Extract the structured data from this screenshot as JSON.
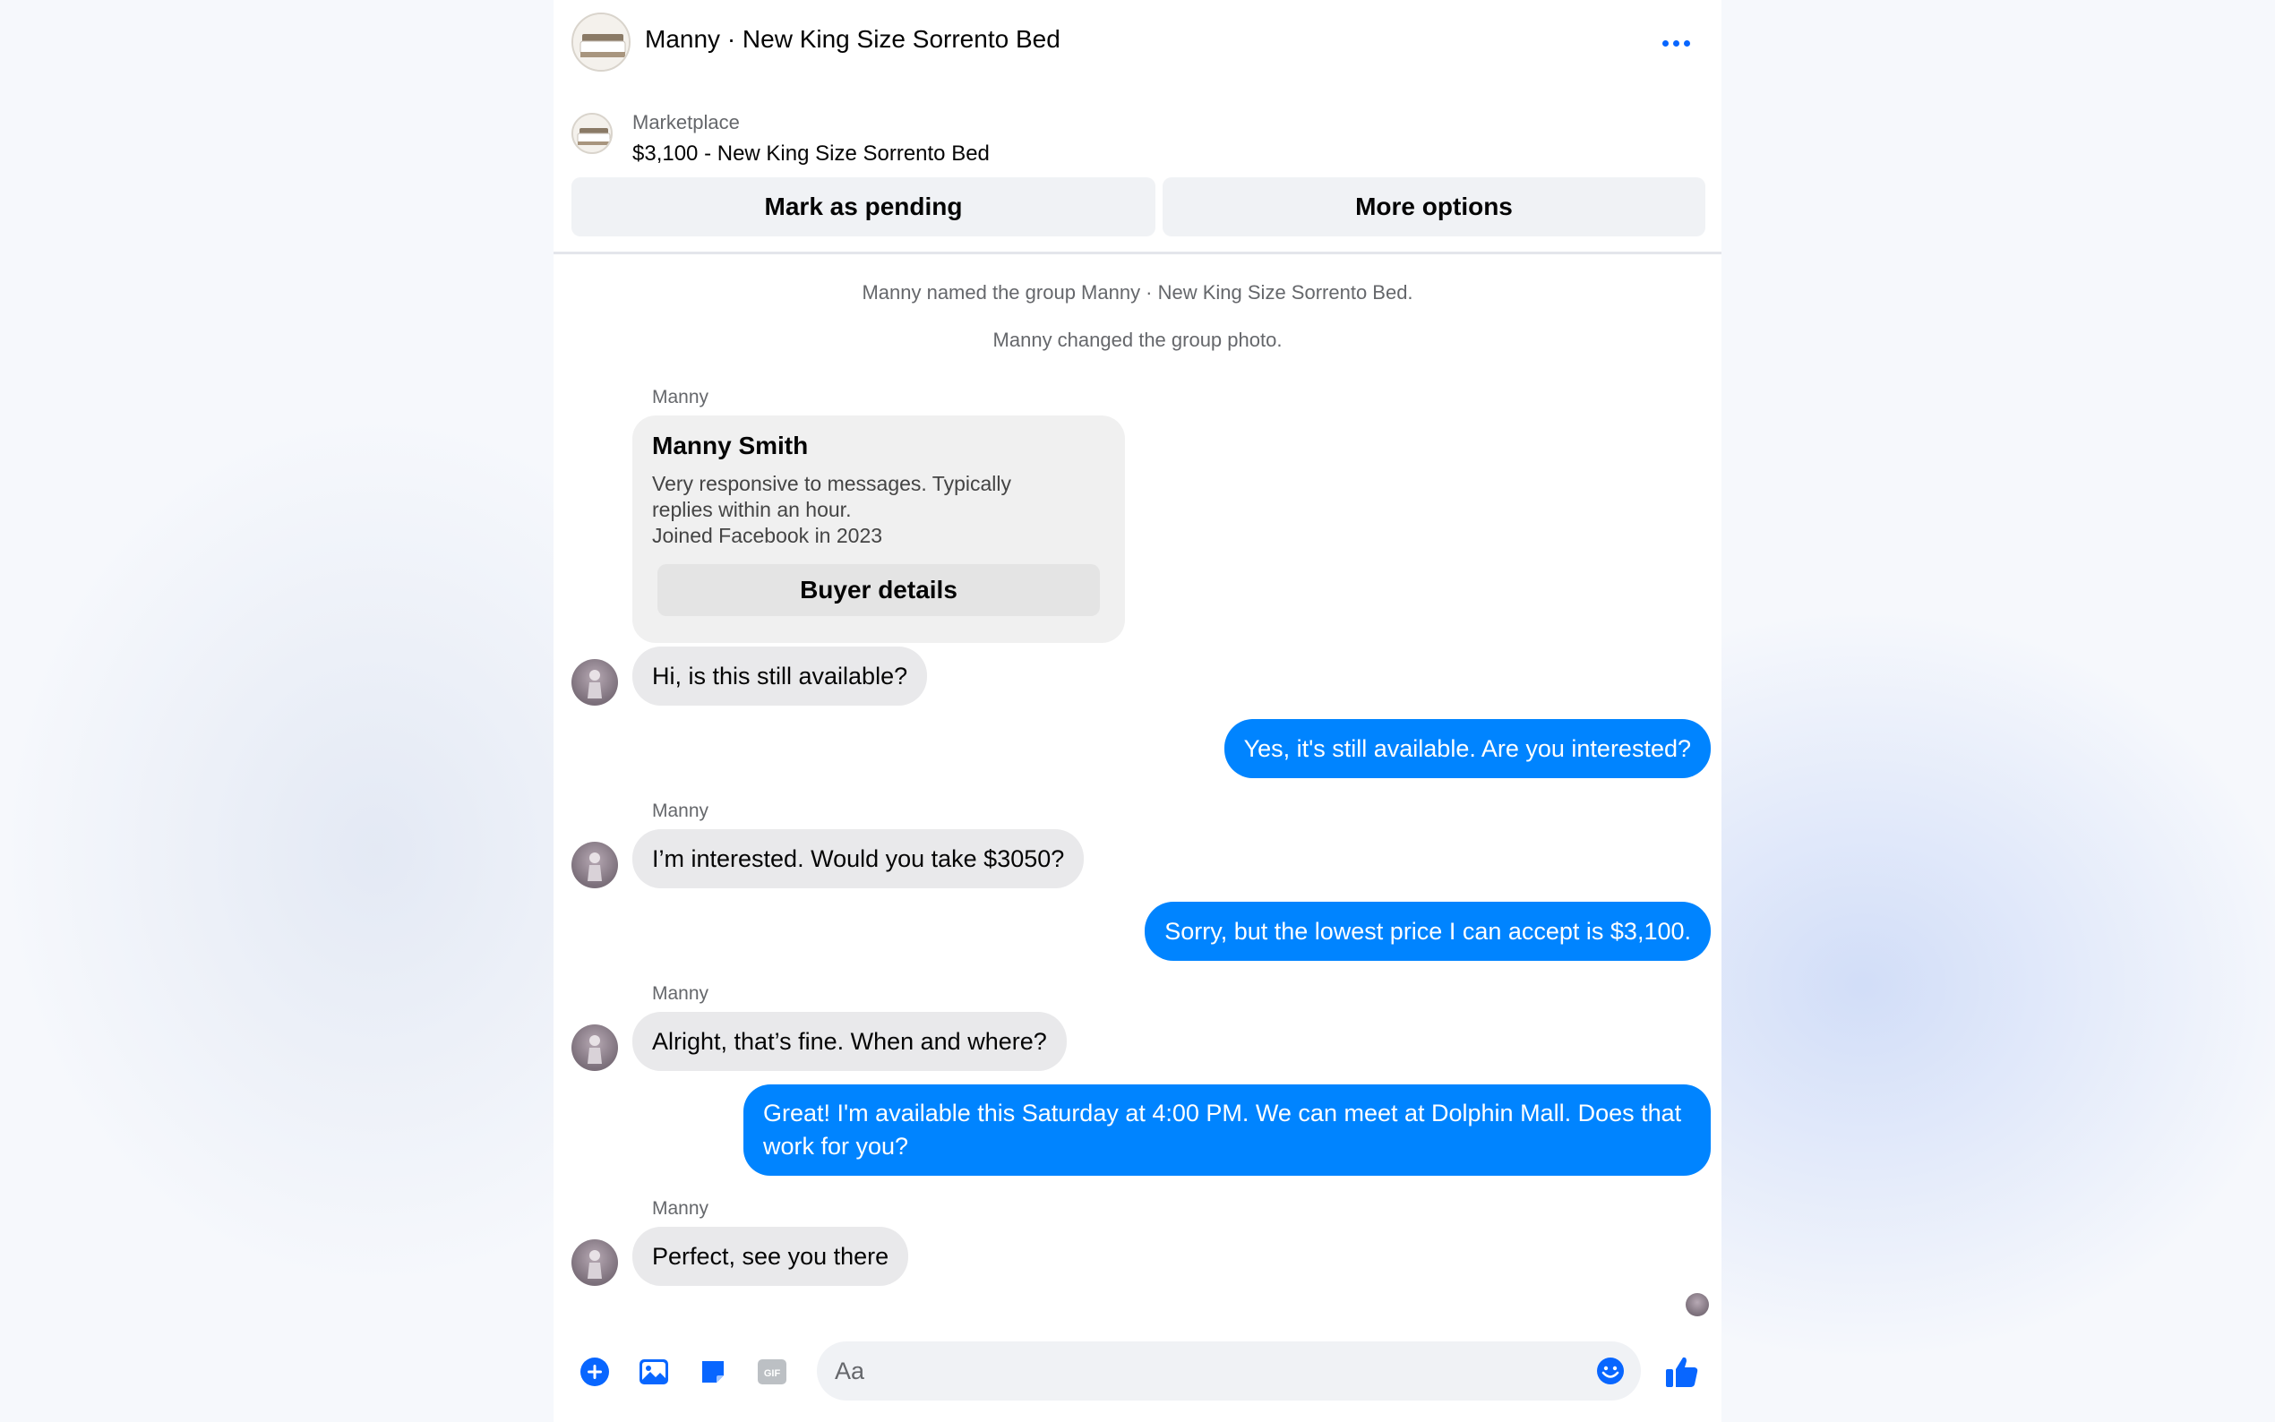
{
  "header": {
    "title": "Manny · New King Size Sorrento Bed",
    "more_icon": "more-horizontal-icon"
  },
  "listing": {
    "label": "Marketplace",
    "title": "$3,100 - New King Size Sorrento Bed",
    "pending_button": "Mark as pending",
    "more_options_button": "More options"
  },
  "system_messages": [
    "Manny named the group Manny · New King Size Sorrento Bed.",
    "Manny changed the group photo."
  ],
  "profile_card": {
    "sender": "Manny",
    "name": "Manny Smith",
    "line1": "Very responsive to messages. Typically",
    "line2": "replies within an hour.",
    "line3": "Joined Facebook in 2023",
    "button": "Buyer details"
  },
  "messages": [
    {
      "from": "Manny",
      "direction": "in",
      "text": "Hi, is this still available?"
    },
    {
      "direction": "out",
      "text": "Yes, it's still available. Are you interested?"
    },
    {
      "from": "Manny",
      "direction": "in",
      "text": "I’m interested. Would you take $3050?"
    },
    {
      "direction": "out",
      "text": "Sorry, but the lowest price I can accept is $3,100."
    },
    {
      "from": "Manny",
      "direction": "in",
      "text": "Alright, that’s fine. When and where?"
    },
    {
      "direction": "out",
      "text": "Great! I'm available this Saturday at 4:00 PM. We can meet at Dolphin Mall. Does that work for you?"
    },
    {
      "from": "Manny",
      "direction": "in",
      "text": "Perfect, see you there"
    }
  ],
  "composer": {
    "placeholder": "Aa",
    "icons": [
      "plus-circle-icon",
      "photo-icon",
      "sticker-icon",
      "gif-icon",
      "emoji-icon",
      "thumbs-up-icon"
    ],
    "gif_label": "GIF"
  },
  "colors": {
    "accent": "#0866ff",
    "outgoing_bubble": "#0084ff",
    "incoming_bubble": "#e9e9eb"
  }
}
